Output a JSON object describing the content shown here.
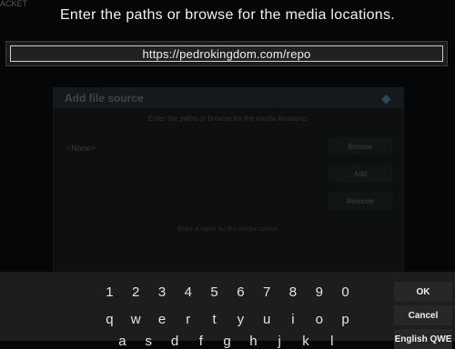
{
  "background_text": "ACKET",
  "prompt": "Enter the paths or browse for the media locations.",
  "url_value": "https://pedrokingdom.com/repo",
  "dialog": {
    "title": "Add file source",
    "subtitle": "Enter the paths or browse for the media locations.",
    "none_item": "<None>",
    "browse": "Browse",
    "add": "Add",
    "remove": "Remove",
    "name_hint": "Enter a name for this media source."
  },
  "keyboard": {
    "row1": [
      "1",
      "2",
      "3",
      "4",
      "5",
      "6",
      "7",
      "8",
      "9",
      "0"
    ],
    "row2": [
      "q",
      "w",
      "e",
      "r",
      "t",
      "y",
      "u",
      "i",
      "o",
      "p"
    ],
    "row3": [
      "a",
      "s",
      "d",
      "f",
      "g",
      "h",
      "j",
      "k",
      "l"
    ],
    "ok": "OK",
    "cancel": "Cancel",
    "layout": "English QWE"
  }
}
